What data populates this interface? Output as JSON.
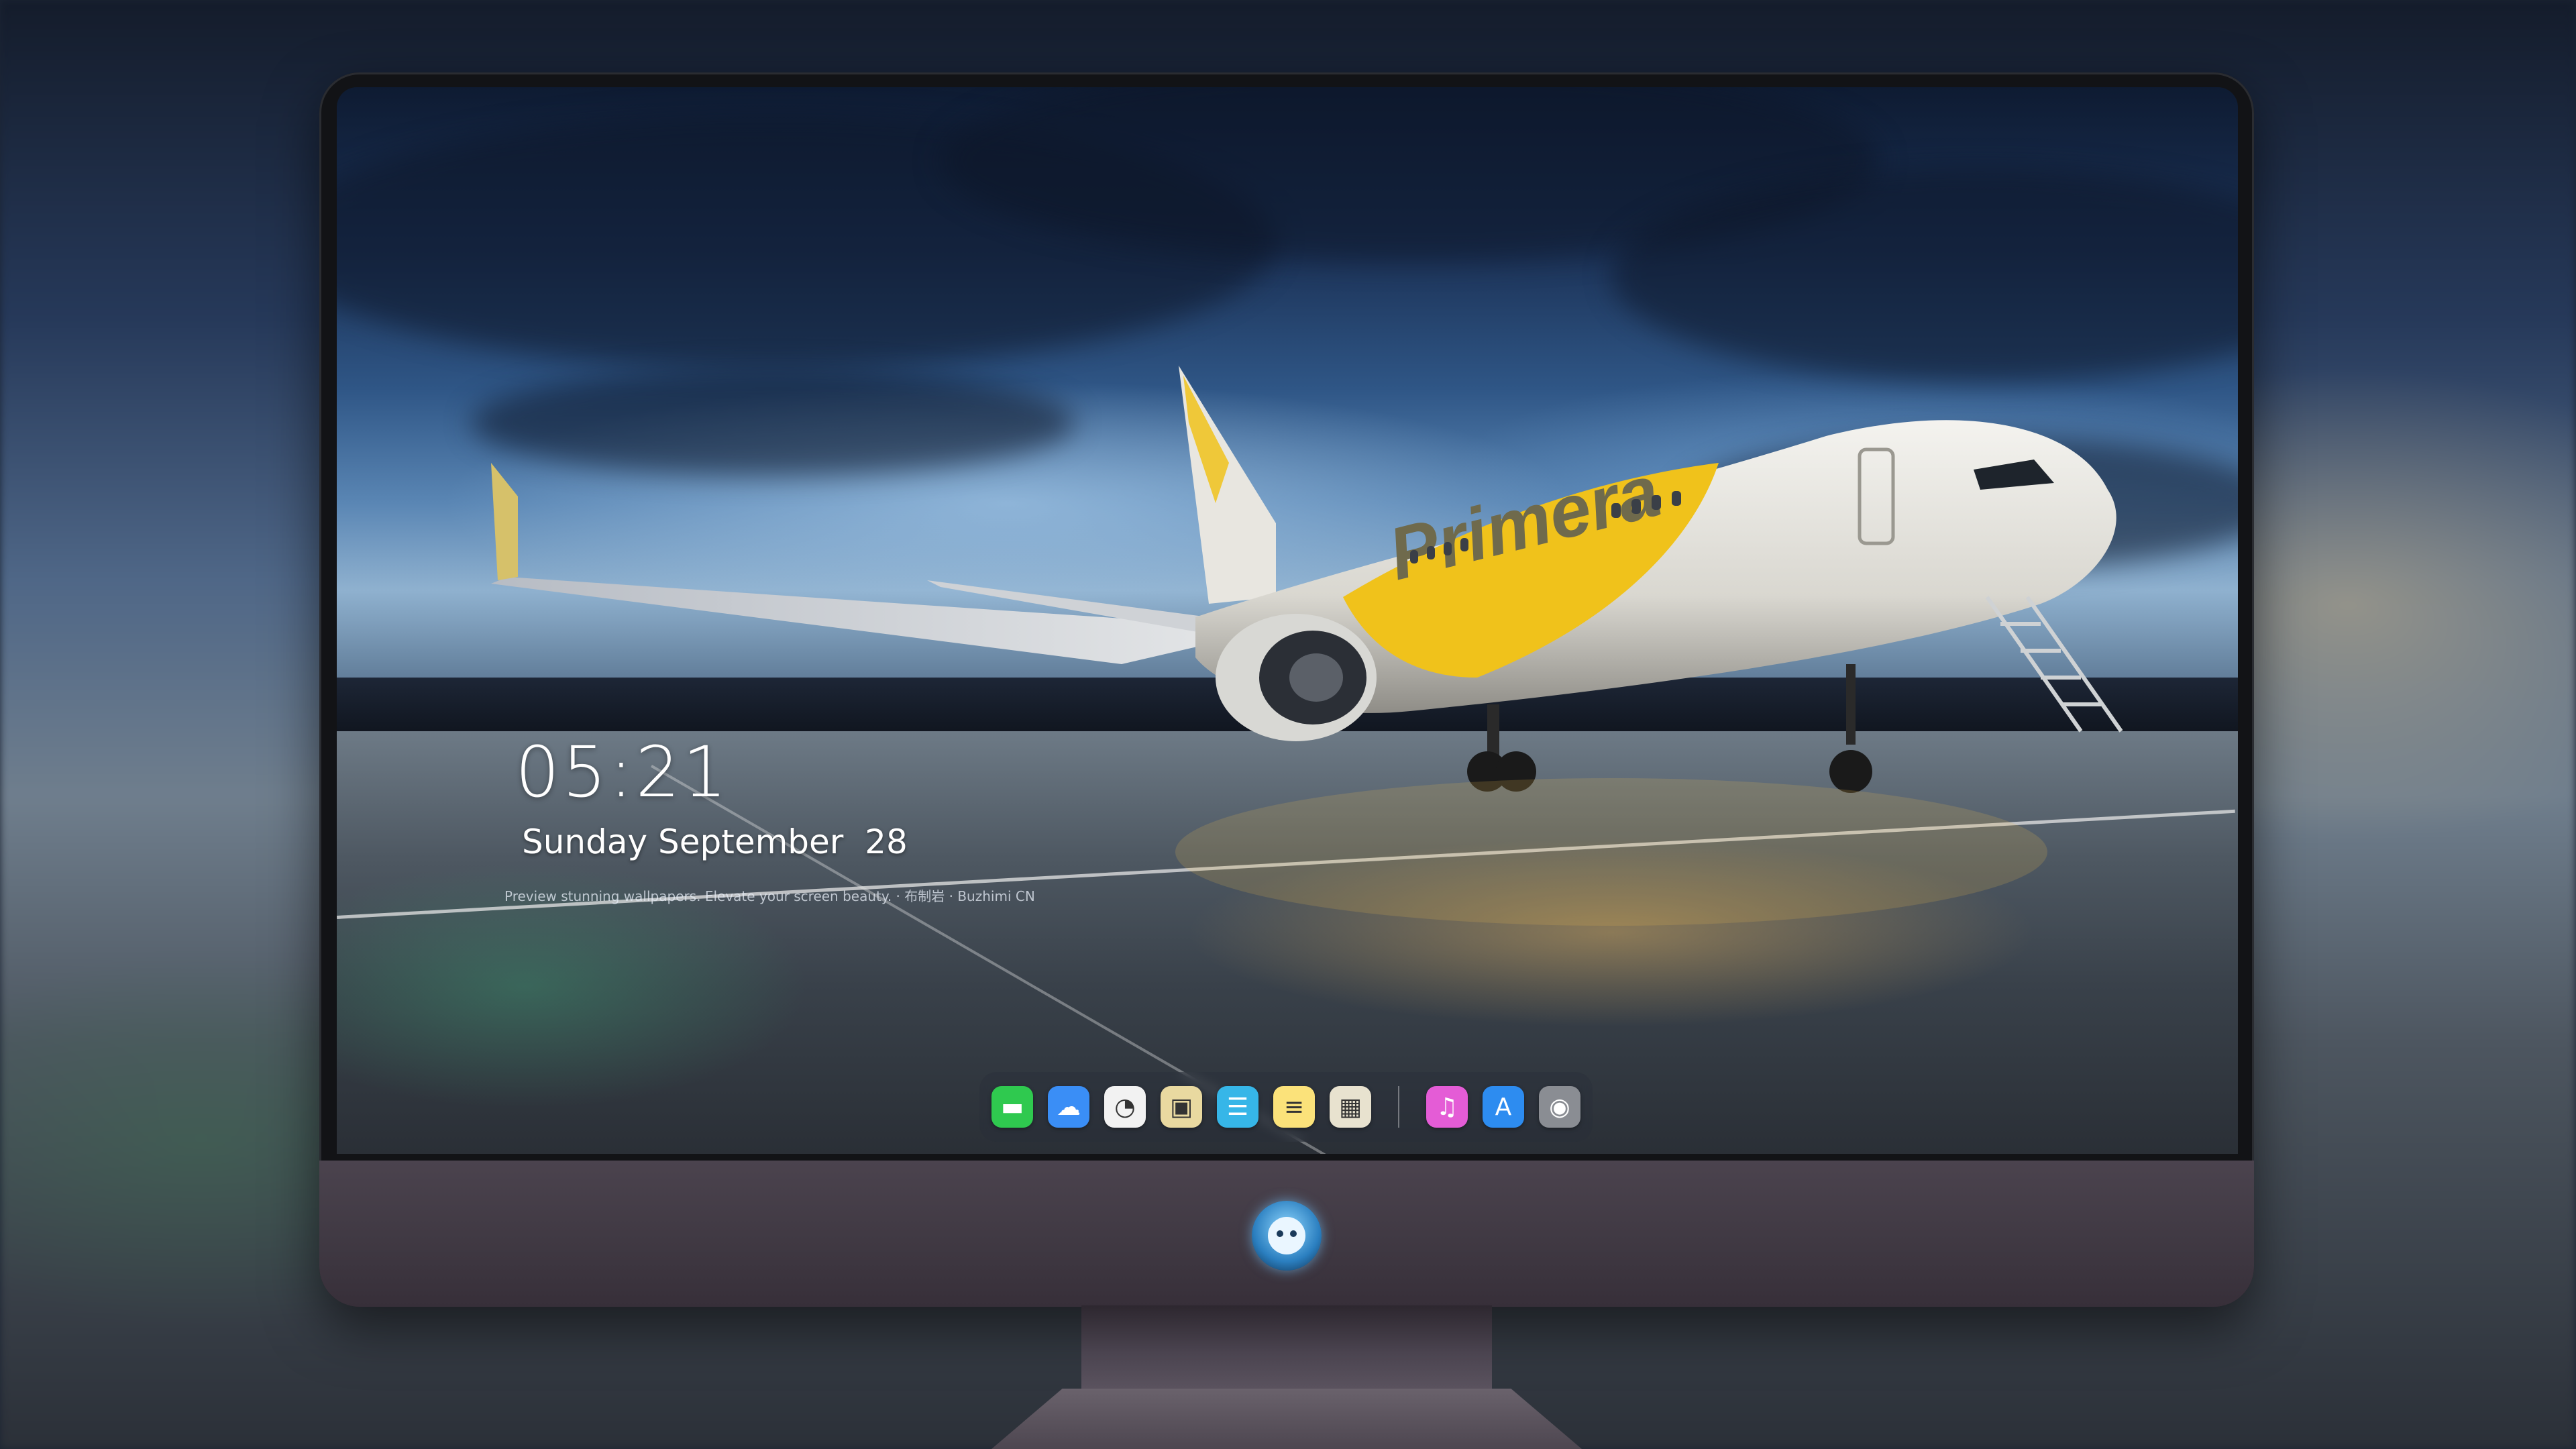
{
  "lock_screen": {
    "time": "05:21",
    "date": "Sunday September  28",
    "tagline": "Preview stunning wallpapers. Elevate your screen beauty. · 布制岩 · Buzhimi CN"
  },
  "wallpaper": {
    "airline_livery": "Primera"
  },
  "dock": {
    "apps": [
      {
        "name": "messages-icon",
        "glyph": "▬",
        "color": "#2fc94f"
      },
      {
        "name": "weather-icon",
        "glyph": "☁",
        "color": "#3a8ef6"
      },
      {
        "name": "clock-icon",
        "glyph": "◔",
        "color": "#f2f2f2"
      },
      {
        "name": "preview-icon",
        "glyph": "▣",
        "color": "#e9d9a0"
      },
      {
        "name": "clips-icon",
        "glyph": "☰",
        "color": "#36b6e8"
      },
      {
        "name": "notes-icon",
        "glyph": "≡",
        "color": "#fbe27a"
      },
      {
        "name": "photo-booth-icon",
        "glyph": "▦",
        "color": "#e8e2cf"
      }
    ],
    "apps_right": [
      {
        "name": "music-icon",
        "glyph": "♫",
        "color": "#e45cd6"
      },
      {
        "name": "app-store-icon",
        "glyph": "A",
        "color": "#2d8cf0"
      },
      {
        "name": "camera-icon",
        "glyph": "◉",
        "color": "#8a8d93"
      }
    ]
  },
  "colors": {
    "bezel": "#121316",
    "chin": "#443c47",
    "livery_yellow": "#f0c21b",
    "fuselage": "#ecebe6"
  }
}
